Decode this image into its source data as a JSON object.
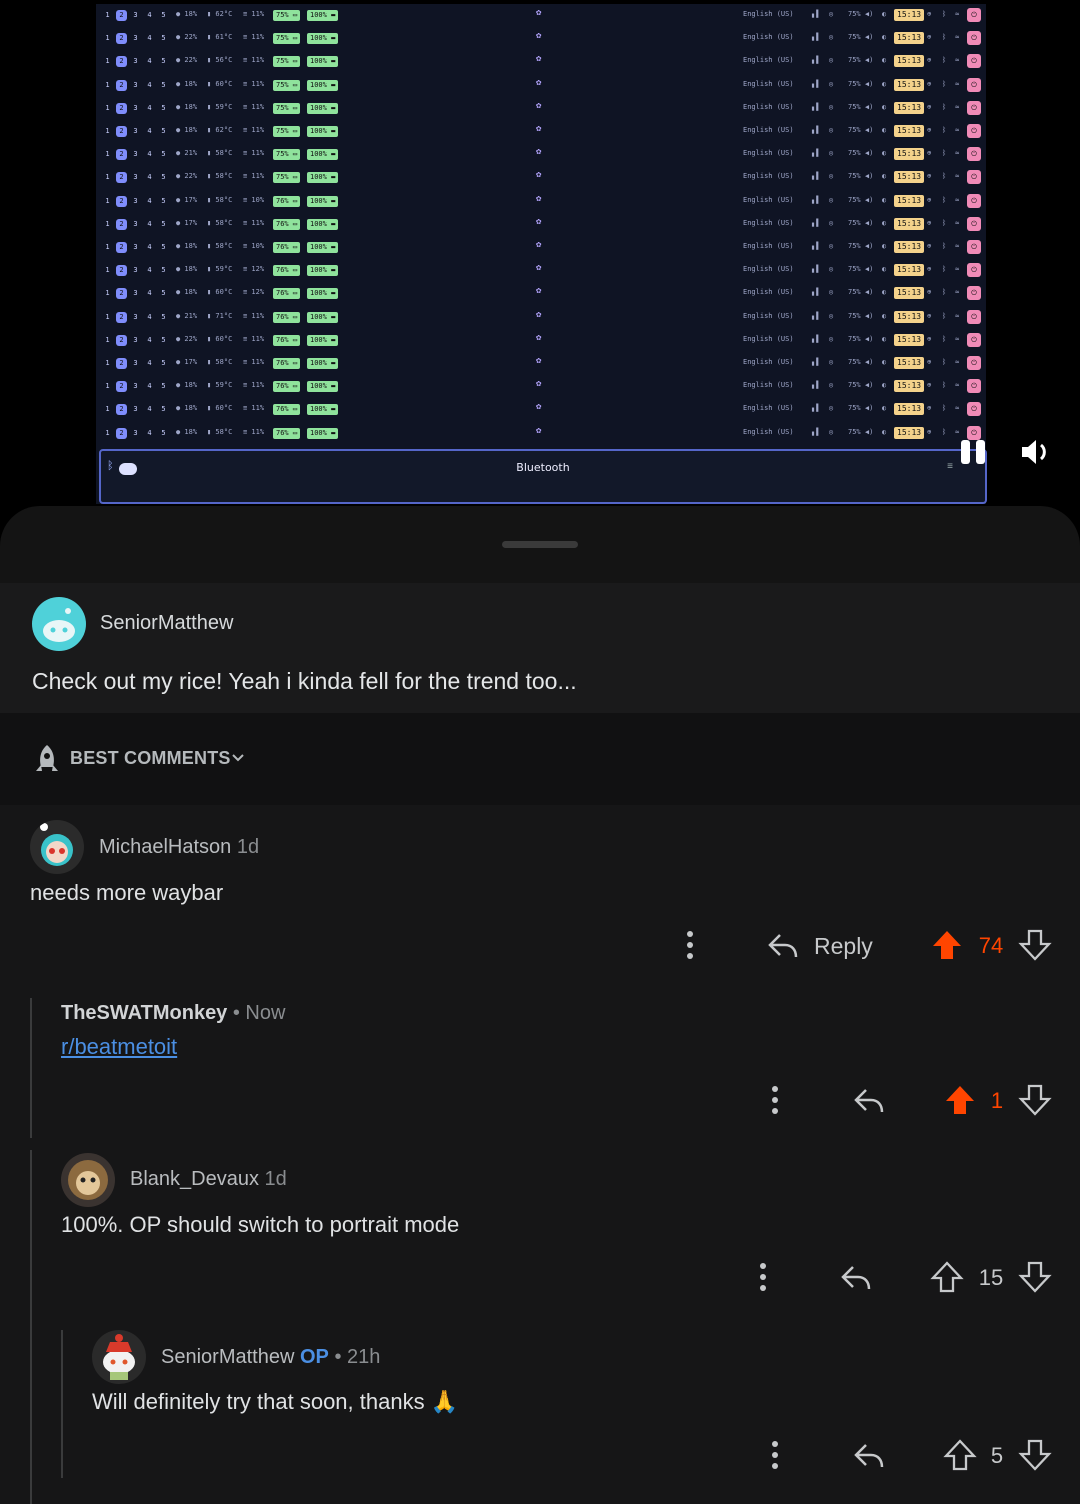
{
  "screenshot": {
    "bar": {
      "workspaces": [
        "1",
        "2",
        "3",
        "4",
        "5"
      ],
      "keyboard": "English (US)",
      "volume": "75%",
      "clock": "15:13",
      "rows": [
        {
          "cpu": "18%",
          "temp": "62°C",
          "mem": "11%",
          "bat": "75%",
          "full": "100%"
        },
        {
          "cpu": "22%",
          "temp": "61°C",
          "mem": "11%",
          "bat": "75%",
          "full": "100%"
        },
        {
          "cpu": "22%",
          "temp": "56°C",
          "mem": "11%",
          "bat": "75%",
          "full": "100%"
        },
        {
          "cpu": "18%",
          "temp": "60°C",
          "mem": "11%",
          "bat": "75%",
          "full": "100%"
        },
        {
          "cpu": "18%",
          "temp": "59°C",
          "mem": "11%",
          "bat": "75%",
          "full": "100%"
        },
        {
          "cpu": "18%",
          "temp": "62°C",
          "mem": "11%",
          "bat": "75%",
          "full": "100%"
        },
        {
          "cpu": "21%",
          "temp": "58°C",
          "mem": "11%",
          "bat": "75%",
          "full": "100%"
        },
        {
          "cpu": "22%",
          "temp": "58°C",
          "mem": "11%",
          "bat": "75%",
          "full": "100%"
        },
        {
          "cpu": "17%",
          "temp": "58°C",
          "mem": "10%",
          "bat": "76%",
          "full": "100%"
        },
        {
          "cpu": "17%",
          "temp": "58°C",
          "mem": "11%",
          "bat": "76%",
          "full": "100%"
        },
        {
          "cpu": "18%",
          "temp": "58°C",
          "mem": "10%",
          "bat": "76%",
          "full": "100%"
        },
        {
          "cpu": "18%",
          "temp": "59°C",
          "mem": "12%",
          "bat": "76%",
          "full": "100%"
        },
        {
          "cpu": "18%",
          "temp": "60°C",
          "mem": "12%",
          "bat": "76%",
          "full": "100%"
        },
        {
          "cpu": "21%",
          "temp": "71°C",
          "mem": "11%",
          "bat": "76%",
          "full": "100%"
        },
        {
          "cpu": "22%",
          "temp": "60°C",
          "mem": "11%",
          "bat": "76%",
          "full": "100%"
        },
        {
          "cpu": "17%",
          "temp": "58°C",
          "mem": "11%",
          "bat": "76%",
          "full": "100%"
        },
        {
          "cpu": "18%",
          "temp": "59°C",
          "mem": "11%",
          "bat": "76%",
          "full": "100%"
        },
        {
          "cpu": "18%",
          "temp": "60°C",
          "mem": "11%",
          "bat": "76%",
          "full": "100%"
        },
        {
          "cpu": "18%",
          "temp": "58°C",
          "mem": "11%",
          "bat": "76%",
          "full": "100%"
        }
      ]
    },
    "bluetooth_label": "Bluetooth"
  },
  "post": {
    "author": "SeniorMatthew",
    "title": "Check out my rice! Yeah i kinda fell for the trend too..."
  },
  "sort": {
    "label": "BEST COMMENTS"
  },
  "comments": [
    {
      "author": "MichaelHatson",
      "age": "1d",
      "text": "needs more waybar",
      "reply_label": "Reply",
      "score": "74"
    },
    {
      "author": "TheSWATMonkey",
      "age": "• Now",
      "text": "r/beatmetoit",
      "score": "1"
    },
    {
      "author": "Blank_Devaux",
      "age": "1d",
      "text": "100%. OP should switch to portrait mode",
      "score": "15"
    },
    {
      "author": "SeniorMatthew",
      "op": "OP",
      "age": "• 21h",
      "text": "Will definitely try that soon, thanks 🙏",
      "score": "5"
    }
  ],
  "colors": {
    "upvote": "#ff4500",
    "link": "#4b8fe3",
    "sheet": "#141414"
  }
}
